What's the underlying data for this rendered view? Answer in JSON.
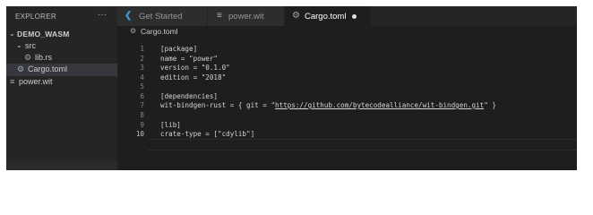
{
  "explorer": {
    "title": "EXPLORER",
    "more_icon": "ellipsis-icon",
    "tree": [
      {
        "label": "DEMO_WASM",
        "icon": "chevron-down-icon"
      },
      {
        "label": "src",
        "icon": "chevron-down-icon"
      },
      {
        "label": "lib.rs",
        "icon": "rust-file-icon"
      },
      {
        "label": "Cargo.toml",
        "icon": "gear-file-icon"
      },
      {
        "label": "power.wit",
        "icon": "text-file-icon"
      }
    ]
  },
  "tabs": [
    {
      "label": "Get Started",
      "icon": "vscode-logo-icon",
      "active": false
    },
    {
      "label": "power.wit",
      "icon": "text-file-icon",
      "active": false
    },
    {
      "label": "Cargo.toml",
      "icon": "gear-file-icon",
      "active": true,
      "dirty": true
    }
  ],
  "breadcrumb": {
    "label": "Cargo.toml",
    "icon": "gear-file-icon"
  },
  "editor": {
    "current_line": 10,
    "lines": [
      {
        "n": "1",
        "text": "[package]"
      },
      {
        "n": "2",
        "text": "name = \"power\""
      },
      {
        "n": "3",
        "text": "version = \"0.1.0\""
      },
      {
        "n": "4",
        "text": "edition = \"2018\""
      },
      {
        "n": "5",
        "text": ""
      },
      {
        "n": "6",
        "text": "[dependencies]"
      },
      {
        "n": "7",
        "text": "wit-bindgen-rust = { git = \"",
        "url": "https://github.com/bytecodealliance/wit-bindgen.git",
        "after": "\" }"
      },
      {
        "n": "8",
        "text": ""
      },
      {
        "n": "9",
        "text": "[lib]"
      },
      {
        "n": "10",
        "text": "crate-type = [\"cdylib\"]"
      }
    ]
  },
  "colors": {
    "editor_bg": "#1e1e1e",
    "sidebar_bg": "#252526",
    "selected_row": "#37373d",
    "vscode_blue": "#3c99d4",
    "rust_icon": "#a0a0a0"
  }
}
